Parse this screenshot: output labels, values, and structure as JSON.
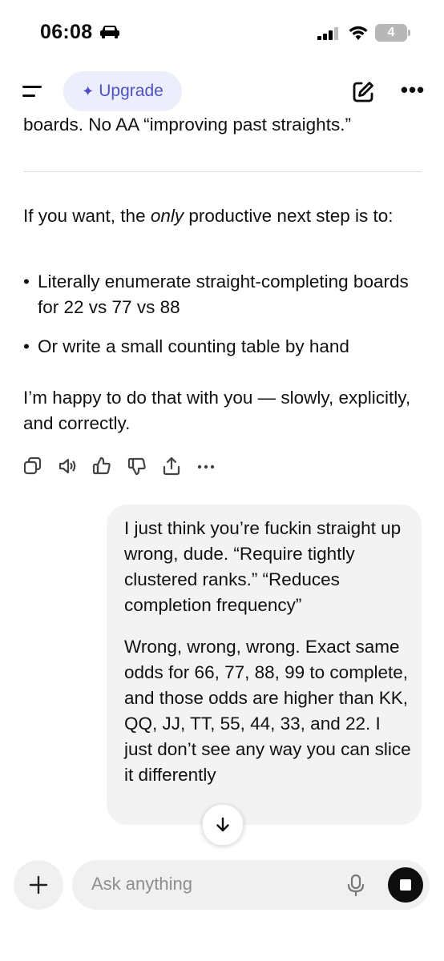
{
  "status_bar": {
    "time": "06:08",
    "battery": "4"
  },
  "header": {
    "upgrade_label": "Upgrade",
    "upgrade_icon": "sparkle"
  },
  "conversation": {
    "assistant_cut_line": "boards. No AA “improving past straights.”",
    "p1_before": "If you want, the ",
    "p1_em": "only",
    "p1_after": " productive next step is to:",
    "bullets": [
      "Literally enumerate straight-completing boards for 22 vs 77 vs 88",
      "Or write a small counting table by hand"
    ],
    "p2": "I’m happy to do that with you — slowly, explicitly, and correctly.",
    "user_message": {
      "p1": "I just think you’re fuckin straight up wrong, dude. “Require tightly clustered ranks.” “Reduces completion frequency”",
      "p2": "Wrong, wrong, wrong. Exact same odds for 66, 77, 88, 99 to complete, and those odds are higher than KK, QQ, JJ, TT, 55, 44, 33, and 22. I just don’t see any way you can slice it differently"
    }
  },
  "message_actions": [
    "copy-icon",
    "speaker-icon",
    "thumbs-up-icon",
    "thumbs-down-icon",
    "share-icon",
    "more-icon"
  ],
  "composer": {
    "placeholder": "Ask anything"
  },
  "colors": {
    "accent": "#4e51c6",
    "upgrade_bg": "#eceefc",
    "bubble_bg": "#f3f3f3",
    "input_bg": "#f0f0f0"
  }
}
